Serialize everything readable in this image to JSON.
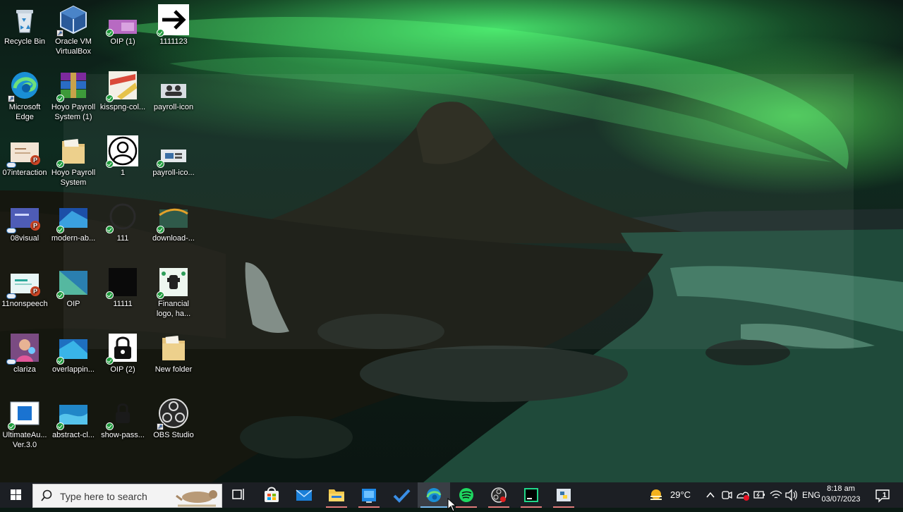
{
  "desktop": {
    "icons": [
      {
        "label": "Recycle Bin",
        "icon": "recycle-bin-icon"
      },
      {
        "label": "Oracle VM\nVirtualBox",
        "icon": "virtualbox-icon"
      },
      {
        "label": "OIP (1)",
        "icon": "image-thumbnail-icon"
      },
      {
        "label": "1111123",
        "icon": "arrow-image-icon"
      },
      {
        "label": "Microsoft\nEdge",
        "icon": "edge-icon"
      },
      {
        "label": "Hoyo Payroll\nSystem (1)",
        "icon": "winrar-archive-icon"
      },
      {
        "label": "kisspng-col...",
        "icon": "image-thumbnail-icon"
      },
      {
        "label": "payroll-icon",
        "icon": "payroll-image-icon"
      },
      {
        "label": "07interaction",
        "icon": "powerpoint-file-icon"
      },
      {
        "label": "Hoyo Payroll\nSystem",
        "icon": "folder-icon"
      },
      {
        "label": "1",
        "icon": "user-avatar-icon"
      },
      {
        "label": "payroll-ico...",
        "icon": "payroll-image-icon"
      },
      {
        "label": "08visual",
        "icon": "powerpoint-file-icon"
      },
      {
        "label": "modern-ab...",
        "icon": "image-thumbnail-icon"
      },
      {
        "label": "111",
        "icon": "image-thumbnail-icon"
      },
      {
        "label": "download-...",
        "icon": "image-thumbnail-icon"
      },
      {
        "label": "11nonspeech",
        "icon": "powerpoint-file-icon"
      },
      {
        "label": "OIP",
        "icon": "image-thumbnail-icon"
      },
      {
        "label": "11111",
        "icon": "image-thumbnail-icon"
      },
      {
        "label": "Financial\nlogo, ha...",
        "icon": "image-thumbnail-icon"
      },
      {
        "label": "clariza",
        "icon": "photo-icon"
      },
      {
        "label": "overlappin...",
        "icon": "image-thumbnail-icon"
      },
      {
        "label": "OIP (2)",
        "icon": "lock-image-icon"
      },
      {
        "label": "New folder",
        "icon": "folder-icon"
      },
      {
        "label": "UltimateAu...\nVer.3.0",
        "icon": "installer-icon"
      },
      {
        "label": "abstract-cl...",
        "icon": "image-thumbnail-icon"
      },
      {
        "label": "show-pass...",
        "icon": "image-thumbnail-icon"
      },
      {
        "label": "OBS Studio",
        "icon": "obs-studio-icon"
      }
    ]
  },
  "taskbar": {
    "search_placeholder": "Type here to search",
    "apps": [
      {
        "name": "task-view",
        "icon": "task-view-icon"
      },
      {
        "name": "microsoft-store",
        "icon": "store-icon"
      },
      {
        "name": "mail",
        "icon": "mail-icon"
      },
      {
        "name": "file-explorer",
        "icon": "folder-icon"
      },
      {
        "name": "virtualbox",
        "icon": "virtualbox-icon"
      },
      {
        "name": "todo",
        "icon": "checkmark-icon"
      },
      {
        "name": "edge",
        "icon": "edge-icon"
      },
      {
        "name": "spotify",
        "icon": "spotify-icon"
      },
      {
        "name": "obs-studio",
        "icon": "obs-studio-icon"
      },
      {
        "name": "pycharm",
        "icon": "pycharm-icon"
      },
      {
        "name": "python",
        "icon": "python-icon"
      }
    ],
    "weather": {
      "temperature": "29°C",
      "icon": "sun-haze-icon"
    },
    "language": "ENG",
    "time": "8:18 am",
    "date": "03/07/2023",
    "notification_count": "1"
  }
}
